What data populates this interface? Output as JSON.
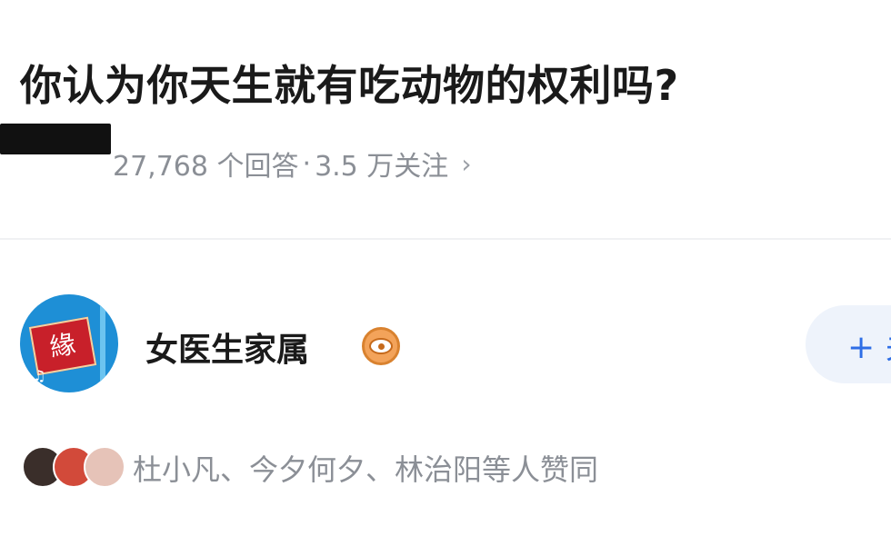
{
  "question": {
    "title": "你认为你天生就有吃动物的权利吗?",
    "answers_count": "27,768 个回答",
    "separator": "·",
    "followers": "3.5 万关注",
    "arrow": "›"
  },
  "answer": {
    "author": {
      "avatar_text": "緣",
      "avatar_music_icon": "♫",
      "name": "女医生家属",
      "badge_icon": "eye-badge-icon"
    },
    "follow_button": {
      "label": "+ 关"
    },
    "voters": {
      "text": "杜小凡、今夕何夕、林治阳等人赞同"
    }
  },
  "colors": {
    "title": "#1a1a1a",
    "muted": "#8b8f96",
    "accent": "#2e6ee6",
    "follow_bg": "#eef3fb",
    "badge": "#f3a35a"
  }
}
